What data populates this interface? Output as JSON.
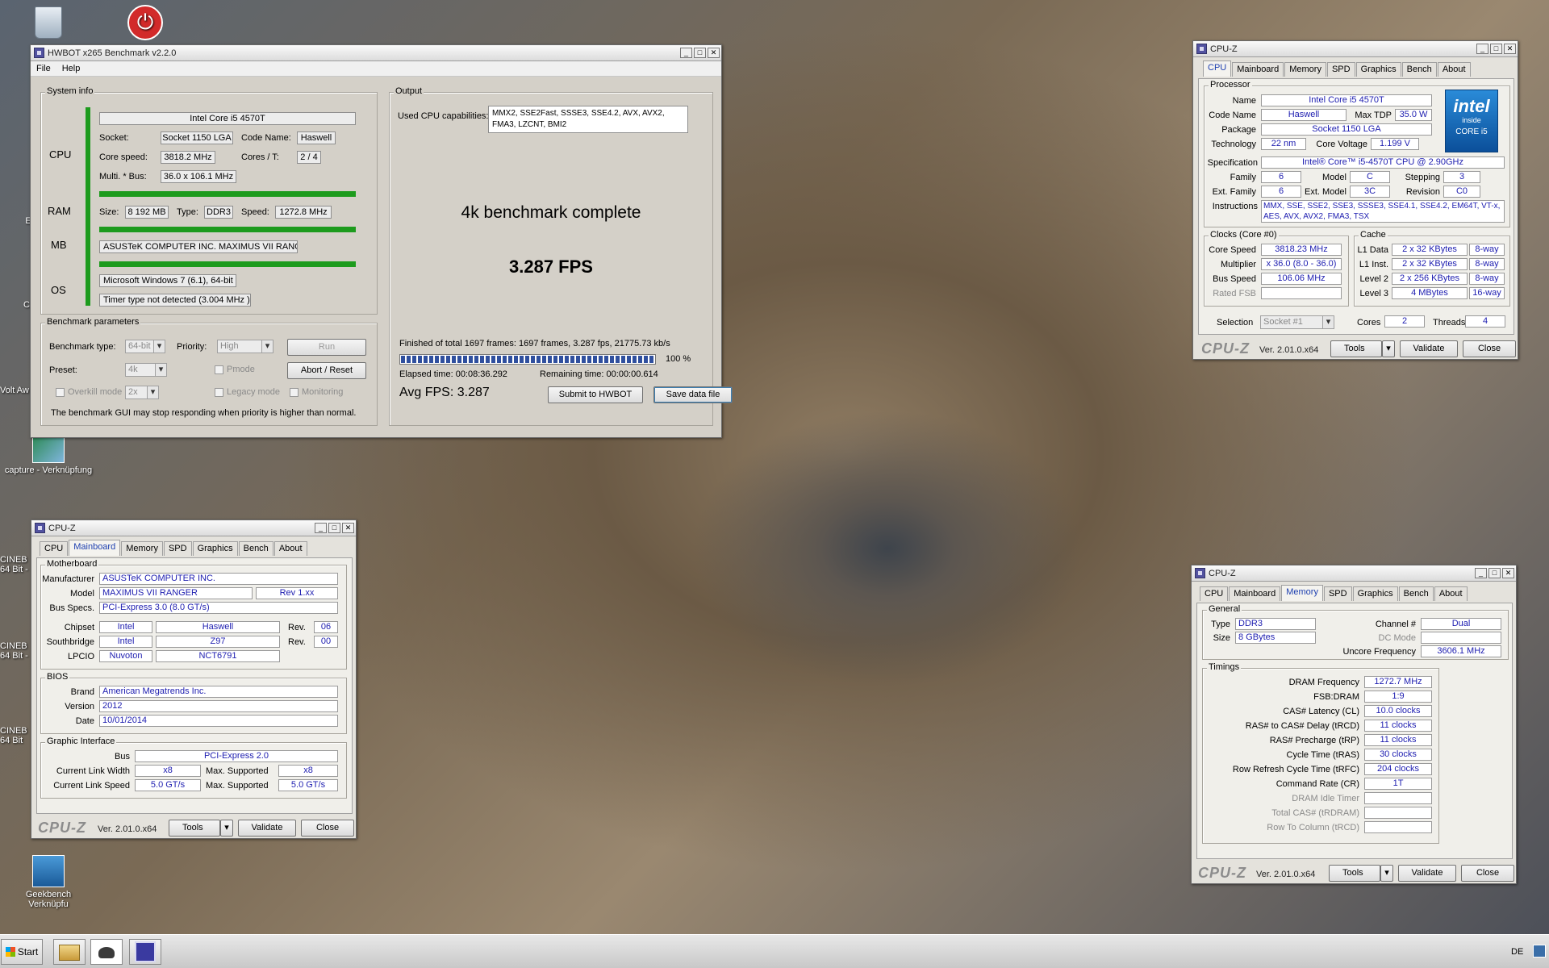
{
  "desktop": {
    "icons": {
      "capture": "capture - Verknüpfung",
      "cine1": "CINEB 64 Bit -",
      "cine2": "CINEB 64 Bit -",
      "cine3": "CINEB 64 Bit",
      "geek": "Geekbench Verknüpfu",
      "volt": "Volt Aw",
      "partial_e": "E",
      "partial_c": "C"
    }
  },
  "hwbot": {
    "title": "HWBOT x265 Benchmark v2.2.0",
    "menu": [
      "File",
      "Help"
    ],
    "sysinfo": {
      "legend": "System info",
      "cpu_label": "CPU",
      "cpu_name": "Intel Core i5 4570T",
      "socket_label": "Socket:",
      "socket": "Socket 1150 LGA",
      "codename_label": "Code Name:",
      "codename": "Haswell",
      "corespeed_label": "Core speed:",
      "corespeed": "3818.2 MHz",
      "cores_label": "Cores / T:",
      "cores": "2 / 4",
      "multi_label": "Multi. * Bus:",
      "multi": "36.0 x 106.1 MHz",
      "ram_label": "RAM",
      "size_label": "Size:",
      "size": "8 192 MB",
      "type_label": "Type:",
      "type": "DDR3",
      "speed_label": "Speed:",
      "speed": "1272.8 MHz",
      "mb_label": "MB",
      "mb": "ASUSTeK COMPUTER INC. MAXIMUS VII RANGER",
      "os_label": "OS",
      "os": "Microsoft Windows 7 (6.1), 64-bit",
      "timer": "Timer type not detected (3.004 MHz )"
    },
    "params": {
      "legend": "Benchmark parameters",
      "btype_label": "Benchmark type:",
      "btype": "64-bit",
      "priority_label": "Priority:",
      "priority": "High",
      "run": "Run",
      "preset_label": "Preset:",
      "preset": "4k",
      "pmode": "Pmode",
      "abort": "Abort / Reset",
      "overkill": "Overkill mode",
      "overkill_val": "2x",
      "legacy": "Legacy mode",
      "monitoring": "Monitoring",
      "note": "The benchmark GUI may stop responding when priority is higher than normal."
    },
    "output": {
      "legend": "Output",
      "caps_label": "Used CPU capabilities:",
      "caps": "MMX2, SSE2Fast, SSSE3, SSE4.2, AVX, AVX2, FMA3, LZCNT, BMI2",
      "status": "4k benchmark complete",
      "fps": "3.287 FPS",
      "finished": "Finished of total 1697 frames: 1697 frames, 3.287 fps,  21775.73 kb/s",
      "progress": 1.0,
      "percent": "100 %",
      "elapsed": "Elapsed time: 00:08:36.292",
      "remaining": "Remaining time: 00:00:00.614",
      "avg": "Avg FPS: 3.287",
      "submit": "Submit to HWBOT",
      "save": "Save data file"
    }
  },
  "cpuz_tabs": [
    "CPU",
    "Mainboard",
    "Memory",
    "SPD",
    "Graphics",
    "Bench",
    "About"
  ],
  "cpuz_common": {
    "title": "CPU-Z",
    "logo": "CPU-Z",
    "version": "Ver. 2.01.0.x64",
    "tools": "Tools",
    "validate": "Validate",
    "close": "Close"
  },
  "cpuz_cpu": {
    "proc_legend": "Processor",
    "name_label": "Name",
    "name": "Intel Core i5 4570T",
    "codename_label": "Code Name",
    "codename": "Haswell",
    "maxtdp_label": "Max TDP",
    "maxtdp": "35.0 W",
    "package_label": "Package",
    "package": "Socket 1150 LGA",
    "tech_label": "Technology",
    "tech": "22 nm",
    "voltage_label": "Core Voltage",
    "voltage": "1.199 V",
    "spec_label": "Specification",
    "spec": "Intel® Core™ i5-4570T CPU @ 2.90GHz",
    "family_label": "Family",
    "family": "6",
    "model_label": "Model",
    "model": "C",
    "stepping_label": "Stepping",
    "stepping": "3",
    "extfam_label": "Ext. Family",
    "extfam": "6",
    "extmodel_label": "Ext. Model",
    "extmodel": "3C",
    "revision_label": "Revision",
    "revision": "C0",
    "instr_label": "Instructions",
    "instr1": "MMX, SSE, SSE2, SSE3, SSSE3, SSE4.1, SSE4.2, EM64T, VT-x,",
    "instr2": "AES, AVX, AVX2, FMA3, TSX",
    "intel_logo": "intel",
    "intel_inside": "inside",
    "intel_core": "CORE i5",
    "clocks_legend": "Clocks (Core #0)",
    "corespeed_label": "Core Speed",
    "corespeed": "3818.23 MHz",
    "mult_label": "Multiplier",
    "mult": "x 36.0 (8.0 - 36.0)",
    "bus_label": "Bus Speed",
    "bus": "106.06 MHz",
    "rated_label": "Rated FSB",
    "cache_legend": "Cache",
    "l1d_label": "L1 Data",
    "l1d": "2 x 32 KBytes",
    "l1d_way": "8-way",
    "l1i_label": "L1 Inst.",
    "l1i": "2 x 32 KBytes",
    "l1i_way": "8-way",
    "l2_label": "Level 2",
    "l2": "2 x 256 KBytes",
    "l2_way": "8-way",
    "l3_label": "Level 3",
    "l3": "4 MBytes",
    "l3_way": "16-way",
    "sel_label": "Selection",
    "sel": "Socket #1",
    "cores_label": "Cores",
    "cores": "2",
    "threads_label": "Threads",
    "threads": "4"
  },
  "cpuz_mb": {
    "mb_legend": "Motherboard",
    "manuf_label": "Manufacturer",
    "manuf": "ASUSTeK COMPUTER INC.",
    "model_label": "Model",
    "model": "MAXIMUS VII RANGER",
    "rev": "Rev 1.xx",
    "busspecs_label": "Bus Specs.",
    "busspecs": "PCI-Express 3.0 (8.0 GT/s)",
    "chipset_label": "Chipset",
    "chipset": "Intel",
    "chipset2": "Haswell",
    "rev_label": "Rev.",
    "chipset_rev": "06",
    "sb_label": "Southbridge",
    "sb": "Intel",
    "sb2": "Z97",
    "sb_rev": "00",
    "lpcio_label": "LPCIO",
    "lpcio": "Nuvoton",
    "lpcio2": "NCT6791",
    "bios_legend": "BIOS",
    "brand_label": "Brand",
    "brand": "American Megatrends Inc.",
    "version_label": "Version",
    "version": "2012",
    "date_label": "Date",
    "date": "10/01/2014",
    "gi_legend": "Graphic Interface",
    "gbus_label": "Bus",
    "gbus": "PCI-Express 2.0",
    "clw_label": "Current Link Width",
    "clw": "x8",
    "maxsup_label": "Max. Supported",
    "maxsup_w": "x8",
    "cls_label": "Current Link Speed",
    "cls": "5.0 GT/s",
    "maxsup_s": "5.0 GT/s"
  },
  "cpuz_mem": {
    "gen_legend": "General",
    "type_label": "Type",
    "type": "DDR3",
    "chan_label": "Channel #",
    "chan": "Dual",
    "size_label": "Size",
    "size": "8 GBytes",
    "dc_label": "DC Mode",
    "uncore_label": "Uncore Frequency",
    "uncore": "3606.1 MHz",
    "tim_legend": "Timings",
    "timings": [
      {
        "label": "DRAM Frequency",
        "value": "1272.7 MHz"
      },
      {
        "label": "FSB:DRAM",
        "value": "1:9"
      },
      {
        "label": "CAS# Latency (CL)",
        "value": "10.0 clocks"
      },
      {
        "label": "RAS# to CAS# Delay (tRCD)",
        "value": "11 clocks"
      },
      {
        "label": "RAS# Precharge (tRP)",
        "value": "11 clocks"
      },
      {
        "label": "Cycle Time (tRAS)",
        "value": "30 clocks"
      },
      {
        "label": "Row Refresh Cycle Time (tRFC)",
        "value": "204 clocks"
      },
      {
        "label": "Command Rate (CR)",
        "value": "1T"
      },
      {
        "label": "DRAM Idle Timer",
        "value": ""
      },
      {
        "label": "Total CAS# (tRDRAM)",
        "value": ""
      },
      {
        "label": "Row To Column (tRCD)",
        "value": ""
      }
    ]
  },
  "taskbar": {
    "start": "Start",
    "lang": "DE"
  },
  "colors": {
    "accent_blue": "#1d3fb0",
    "progress": "#2f4f9e",
    "green_bar": "#1d9b1d"
  }
}
